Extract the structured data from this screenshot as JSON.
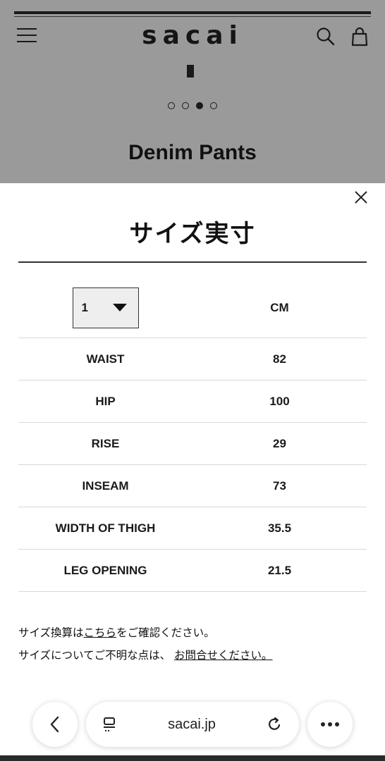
{
  "background_page": {
    "brand": "sacai",
    "product_title": "Denim Pants",
    "carousel": {
      "total": 4,
      "active_index": 2
    }
  },
  "modal": {
    "title": "サイズ実寸",
    "size_select": {
      "selected": "1"
    },
    "unit_label": "CM",
    "rows": [
      {
        "label": "WAIST",
        "value": "82"
      },
      {
        "label": "HIP",
        "value": "100"
      },
      {
        "label": "RISE",
        "value": "29"
      },
      {
        "label": "INSEAM",
        "value": "73"
      },
      {
        "label": "WIDTH OF THIGH",
        "value": "35.5"
      },
      {
        "label": "LEG OPENING",
        "value": "21.5"
      }
    ],
    "notes": {
      "line1_prefix": "サイズ換算は",
      "line1_link": "こちら",
      "line1_suffix": "をご確認ください。",
      "line2_prefix": "サイズについてご不明な点は、",
      "line2_link": "お問合せください。"
    }
  },
  "browser": {
    "url": "sacai.jp"
  },
  "colors": {
    "overlay": "#9a9a9a",
    "modal_bg": "#ffffff",
    "text": "#111111",
    "row_divider": "#d8d8d8"
  },
  "icons": [
    "hamburger-menu-icon",
    "search-icon",
    "bag-icon",
    "close-icon",
    "caret-down-icon",
    "back-arrow-icon",
    "tabs-icon",
    "reload-icon",
    "more-icon"
  ]
}
